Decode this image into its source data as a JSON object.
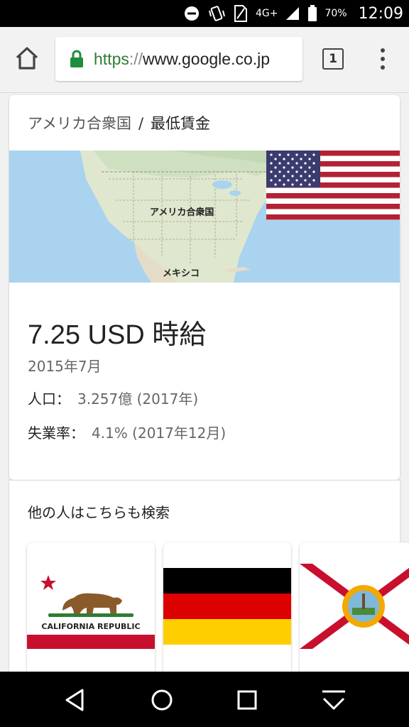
{
  "status_bar": {
    "network": "4G+",
    "battery": "70%",
    "time": "12:09"
  },
  "browser": {
    "url_scheme": "https",
    "url_sep": "://",
    "url_host": "www.google.co.jp",
    "tab_count": "1"
  },
  "breadcrumb": {
    "country": "アメリカ合衆国",
    "separator": "/",
    "topic": "最低賃金"
  },
  "map": {
    "label_usa": "アメリカ合衆国",
    "label_mexico": "メキシコ"
  },
  "info": {
    "wage": "7.25 USD 時給",
    "date": "2015年7月",
    "population_label": "人口：",
    "population_value": "3.257億 (2017年)",
    "unemployment_label": "失業率：",
    "unemployment_value": "4.1% (2017年12月)"
  },
  "related": {
    "title": "他の人はこちらも検索",
    "items": [
      {
        "flag_text": "CALIFORNIA REPUBLIC"
      }
    ]
  }
}
